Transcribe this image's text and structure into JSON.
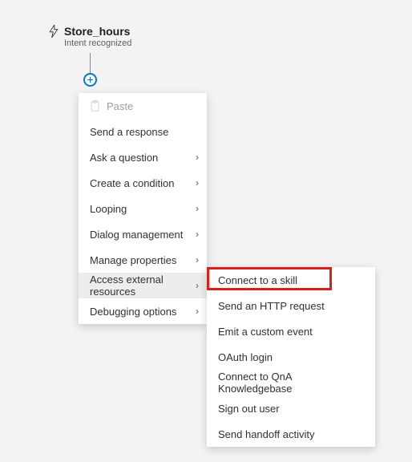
{
  "trigger": {
    "title": "Store_hours",
    "subtitle": "Intent recognized"
  },
  "primaryMenu": {
    "paste": "Paste",
    "items": [
      {
        "label": "Send a response",
        "submenu": false
      },
      {
        "label": "Ask a question",
        "submenu": true
      },
      {
        "label": "Create a condition",
        "submenu": true
      },
      {
        "label": "Looping",
        "submenu": true
      },
      {
        "label": "Dialog management",
        "submenu": true
      },
      {
        "label": "Manage properties",
        "submenu": true
      },
      {
        "label": "Access external resources",
        "submenu": true,
        "hovered": true
      },
      {
        "label": "Debugging options",
        "submenu": true
      }
    ]
  },
  "secondaryMenu": {
    "items": [
      {
        "label": "Connect to a skill"
      },
      {
        "label": "Send an HTTP request"
      },
      {
        "label": "Emit a custom event"
      },
      {
        "label": "OAuth login"
      },
      {
        "label": "Connect to QnA Knowledgebase"
      },
      {
        "label": "Sign out user"
      },
      {
        "label": "Send handoff activity"
      }
    ]
  }
}
